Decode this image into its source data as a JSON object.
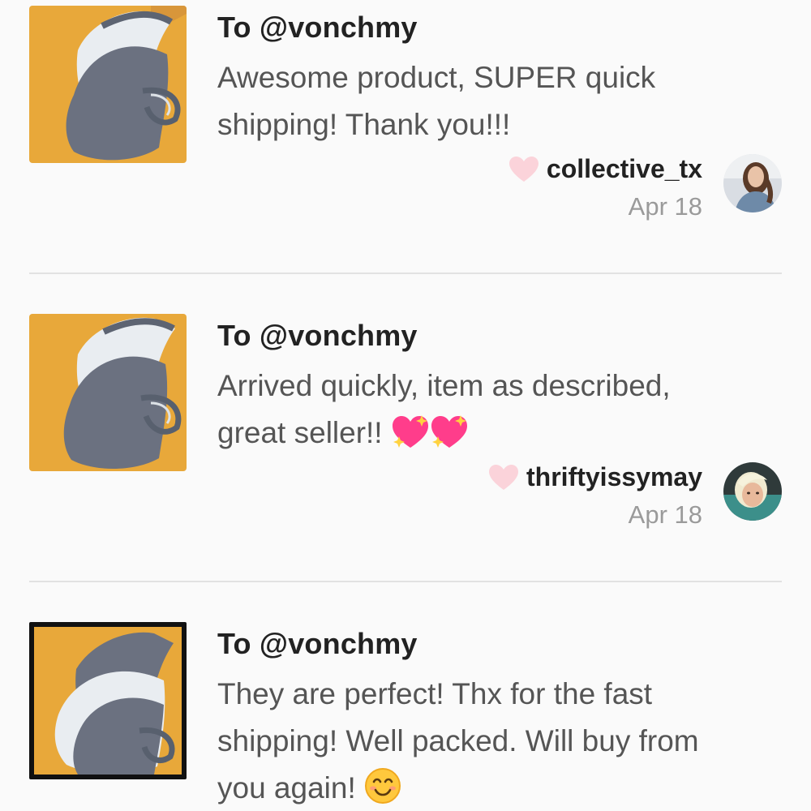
{
  "reviews": [
    {
      "to": "To @vonchmy",
      "message": "Awesome product, SUPER quick shipping! Thank you!!!",
      "message_lines": [
        "Awesome product, SUPER quick",
        "shipping! Thank you!!!"
      ],
      "username": "collective_tx",
      "date": "Apr 18",
      "emoji": ""
    },
    {
      "to": "To @vonchmy",
      "message_lines": [
        "Arrived quickly, item as described,",
        "great seller!! "
      ],
      "username": "thriftyissymay",
      "date": "Apr 18",
      "emoji": "sparkling-heart-emoji"
    },
    {
      "to": "To @vonchmy",
      "message_lines": [
        "They are perfect! Thx for the fast",
        "shipping! Well packed. Will buy from",
        "you again! "
      ],
      "emoji": "smiling-face-emoji"
    }
  ],
  "colors": {
    "thumb_bg": "#e8a83a",
    "mask_gray": "#6b7180",
    "mask_white": "#eef1f4",
    "heart": "#fbd3da",
    "divider": "#e2e2e2"
  }
}
